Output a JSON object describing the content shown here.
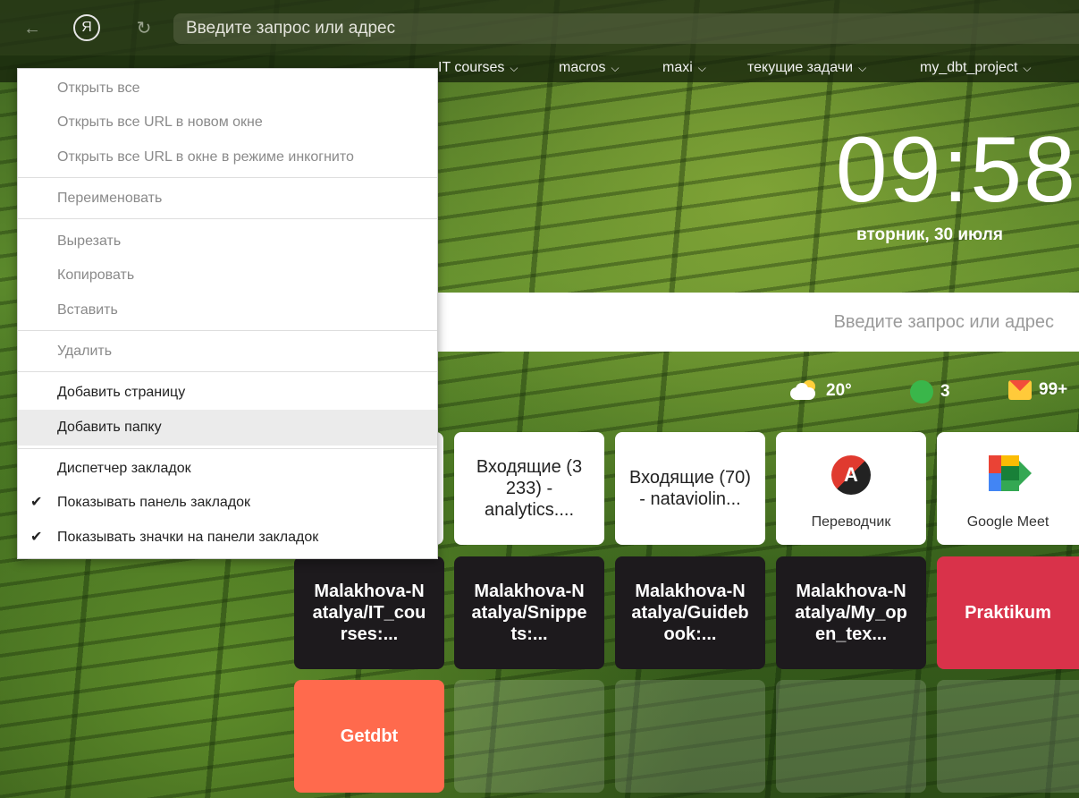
{
  "toolbar": {
    "omnibox_placeholder": "Введите запрос или адрес",
    "yandex_logo": "Я"
  },
  "bookmarks_bar": {
    "items": [
      {
        "label": "IT courses"
      },
      {
        "label": "macros"
      },
      {
        "label": "maxi"
      },
      {
        "label": "текущие задачи"
      },
      {
        "label": "my_dbt_project"
      }
    ]
  },
  "clock": {
    "time": "09:58",
    "date": "вторник, 30 июля"
  },
  "search": {
    "placeholder": "Введите запрос или адрес"
  },
  "widgets": {
    "weather": "20°",
    "messages": "3",
    "mail": "99+"
  },
  "tiles": {
    "row1": [
      {
        "label": "Входящие (3 233) - analytics...."
      },
      {
        "label": "Входящие (70) - nataviolin..."
      },
      {
        "label": "Переводчик",
        "icon": "translator-icon"
      },
      {
        "label": "Google Meet",
        "icon": "google-meet-icon"
      }
    ],
    "row2": [
      {
        "label": "Malakhova-Natalya/IT_courses:..."
      },
      {
        "label": "Malakhova-Natalya/Snippets:..."
      },
      {
        "label": "Malakhova-Natalya/Guidebook:..."
      },
      {
        "label": "Malakhova-Natalya/My_open_tex..."
      },
      {
        "label": "Praktikum"
      }
    ],
    "row3": [
      {
        "label": "Getdbt"
      }
    ]
  },
  "menu": {
    "open_all": "Открыть все",
    "open_all_new_window": "Открыть все URL в новом окне",
    "open_all_incognito": "Открыть все URL в окне в режиме инкогнито",
    "rename": "Переименовать",
    "cut": "Вырезать",
    "copy": "Копировать",
    "paste": "Вставить",
    "delete": "Удалить",
    "add_page": "Добавить страницу",
    "add_folder": "Добавить папку",
    "bookmark_manager": "Диспетчер закладок",
    "show_bookmarks_bar": "Показывать панель закладок",
    "show_bookmark_icons": "Показывать значки на панели закладок"
  },
  "colors": {
    "praktikum_tile": "#d9324a",
    "getdbt_tile": "#ff6a4d",
    "github_tile": "#1d1a1d",
    "menu_highlight": "#ebebeb"
  }
}
